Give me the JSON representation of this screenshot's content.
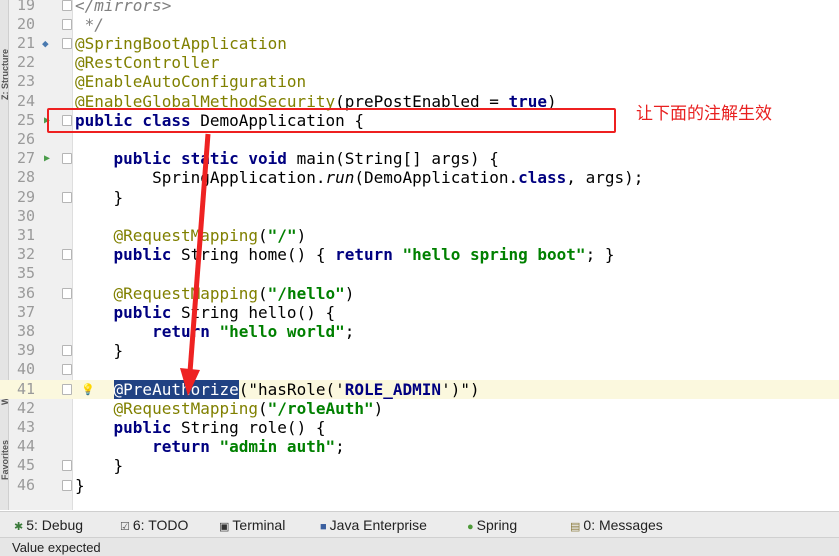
{
  "side_tabs": {
    "structure": "Z: Structure",
    "web": "Web",
    "favorites": "Favorites"
  },
  "annotation_note": "让下面的注解生效",
  "code_lines": [
    {
      "n": "19",
      "tokens": [
        {
          "c": "cm",
          "t": "</mirrors>"
        }
      ]
    },
    {
      "n": "20",
      "tokens": [
        {
          "c": "cm",
          "t": " */"
        }
      ]
    },
    {
      "n": "21",
      "tokens": [
        {
          "c": "an",
          "t": "@SpringBootApplication"
        }
      ]
    },
    {
      "n": "22",
      "tokens": [
        {
          "c": "an",
          "t": "@RestController"
        }
      ]
    },
    {
      "n": "23",
      "tokens": [
        {
          "c": "an",
          "t": "@EnableAutoConfiguration"
        }
      ]
    },
    {
      "n": "24",
      "tokens": [
        {
          "c": "an",
          "t": "@EnableGlobalMethodSecurity"
        },
        {
          "c": "",
          "t": "(prePostEnabled = "
        },
        {
          "c": "kw",
          "t": "true"
        },
        {
          "c": "",
          "t": ")"
        }
      ]
    },
    {
      "n": "25",
      "tokens": [
        {
          "c": "kw",
          "t": "public class "
        },
        {
          "c": "",
          "t": "DemoApplication {"
        }
      ]
    },
    {
      "n": "26",
      "tokens": []
    },
    {
      "n": "27",
      "tokens": [
        {
          "c": "",
          "t": "    "
        },
        {
          "c": "kw",
          "t": "public static void "
        },
        {
          "c": "",
          "t": "main(String[] args) {"
        }
      ]
    },
    {
      "n": "28",
      "tokens": [
        {
          "c": "",
          "t": "        SpringApplication."
        },
        {
          "c": "it",
          "t": "run"
        },
        {
          "c": "",
          "t": "(DemoApplication."
        },
        {
          "c": "kw",
          "t": "class"
        },
        {
          "c": "",
          "t": ", args);"
        }
      ]
    },
    {
      "n": "29",
      "tokens": [
        {
          "c": "",
          "t": "    }"
        }
      ]
    },
    {
      "n": "30",
      "tokens": []
    },
    {
      "n": "31",
      "tokens": [
        {
          "c": "",
          "t": "    "
        },
        {
          "c": "an",
          "t": "@RequestMapping"
        },
        {
          "c": "",
          "t": "("
        },
        {
          "c": "st",
          "t": "\"/\""
        },
        {
          "c": "",
          "t": ")"
        }
      ]
    },
    {
      "n": "32",
      "tokens": [
        {
          "c": "",
          "t": "    "
        },
        {
          "c": "kw",
          "t": "public "
        },
        {
          "c": "",
          "t": "String home() { "
        },
        {
          "c": "kw",
          "t": "return "
        },
        {
          "c": "st",
          "t": "\"hello spring boot\""
        },
        {
          "c": "",
          "t": "; }"
        }
      ]
    },
    {
      "n": "35",
      "tokens": []
    },
    {
      "n": "36",
      "tokens": [
        {
          "c": "",
          "t": "    "
        },
        {
          "c": "an",
          "t": "@RequestMapping"
        },
        {
          "c": "",
          "t": "("
        },
        {
          "c": "st",
          "t": "\"/hello\""
        },
        {
          "c": "",
          "t": ")"
        }
      ]
    },
    {
      "n": "37",
      "tokens": [
        {
          "c": "",
          "t": "    "
        },
        {
          "c": "kw",
          "t": "public "
        },
        {
          "c": "",
          "t": "String hello() {"
        }
      ]
    },
    {
      "n": "38",
      "tokens": [
        {
          "c": "",
          "t": "        "
        },
        {
          "c": "kw",
          "t": "return "
        },
        {
          "c": "st",
          "t": "\"hello world\""
        },
        {
          "c": "",
          "t": ";"
        }
      ]
    },
    {
      "n": "39",
      "tokens": [
        {
          "c": "",
          "t": "    }"
        }
      ]
    },
    {
      "n": "40",
      "tokens": []
    },
    {
      "n": "41",
      "tokens": [
        {
          "c": "",
          "t": "    "
        },
        {
          "c": "an sel",
          "t": "@PreAuthorize"
        },
        {
          "c": "",
          "t": "(\"hasRole('"
        },
        {
          "c": "kw",
          "t": "ROLE_ADMIN"
        },
        {
          "c": "",
          "t": "')\")"
        }
      ]
    },
    {
      "n": "42",
      "tokens": [
        {
          "c": "",
          "t": "    "
        },
        {
          "c": "an",
          "t": "@RequestMapping"
        },
        {
          "c": "",
          "t": "("
        },
        {
          "c": "st",
          "t": "\"/roleAuth\""
        },
        {
          "c": "",
          "t": ")"
        }
      ]
    },
    {
      "n": "43",
      "tokens": [
        {
          "c": "",
          "t": "    "
        },
        {
          "c": "kw",
          "t": "public "
        },
        {
          "c": "",
          "t": "String role() {"
        }
      ]
    },
    {
      "n": "44",
      "tokens": [
        {
          "c": "",
          "t": "        "
        },
        {
          "c": "kw",
          "t": "return "
        },
        {
          "c": "st",
          "t": "\"admin auth\""
        },
        {
          "c": "",
          "t": ";"
        }
      ]
    },
    {
      "n": "45",
      "tokens": [
        {
          "c": "",
          "t": "    }"
        }
      ]
    },
    {
      "n": "46",
      "tokens": [
        {
          "c": "",
          "t": "}"
        }
      ]
    }
  ],
  "tool_windows": [
    {
      "name": "debug",
      "label": "5: Debug",
      "icon": "debug-icon",
      "glyph": "✱",
      "color": "#3a7a3a"
    },
    {
      "name": "todo",
      "label": "6: TODO",
      "icon": "todo-icon",
      "glyph": "☑",
      "color": "#555555"
    },
    {
      "name": "terminal",
      "label": "Terminal",
      "icon": "terminal-icon",
      "glyph": "▣",
      "color": "#333333"
    },
    {
      "name": "java-enterprise",
      "label": "Java Enterprise",
      "icon": "java-enterprise-icon",
      "glyph": "■",
      "color": "#3a5f9f"
    },
    {
      "name": "spring",
      "label": "Spring",
      "icon": "spring-icon",
      "glyph": "●",
      "color": "#4e9a3a"
    },
    {
      "name": "messages",
      "label": "0: Messages",
      "icon": "messages-icon",
      "glyph": "▤",
      "color": "#8a7a3a"
    }
  ],
  "status_text": "Value expected"
}
